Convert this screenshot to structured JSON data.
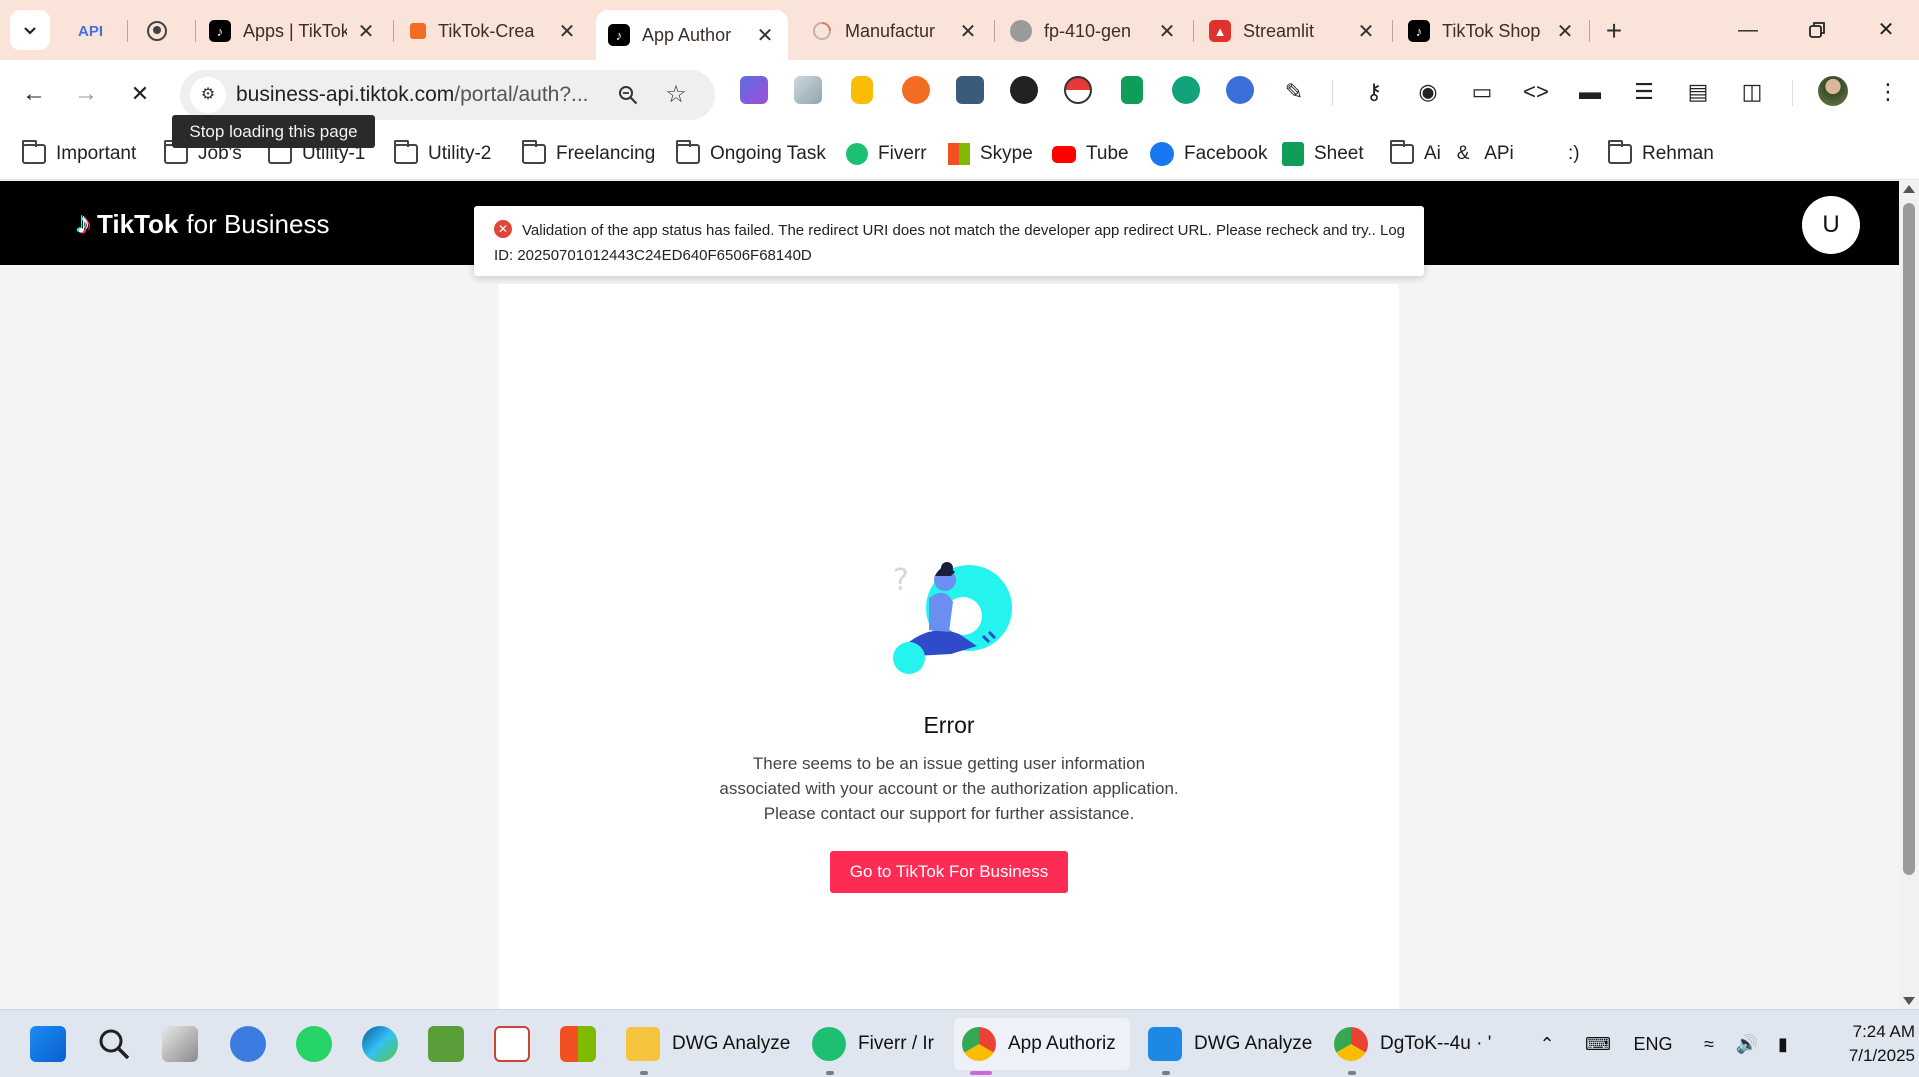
{
  "tabs": [
    {
      "title": "API",
      "favicon": "api-text-icon",
      "has_close": false
    },
    {
      "title": "",
      "favicon": "github-icon",
      "has_close": false
    },
    {
      "title": "Apps | TikTok",
      "favicon": "tiktok-icon",
      "has_close": true
    },
    {
      "title": "TikTok-Crea",
      "favicon": "orange-app-icon",
      "has_close": true
    },
    {
      "title": "App Author",
      "favicon": "tiktok-icon",
      "has_close": true,
      "active": true
    },
    {
      "title": "Manufactur",
      "favicon": "loading-spinner-icon",
      "has_close": true
    },
    {
      "title": "fp-410-gen",
      "favicon": "globe-icon",
      "has_close": true
    },
    {
      "title": "Streamlit",
      "favicon": "streamlit-icon",
      "has_close": true
    },
    {
      "title": "TikTok Shop",
      "favicon": "tiktok-icon",
      "has_close": true
    }
  ],
  "toolbar": {
    "url_host": "business-api.tiktok.com",
    "url_rest": "/portal/auth?...",
    "tooltip": "Stop loading this page"
  },
  "bookmarks": [
    {
      "label": "Important",
      "icon": "folder-icon"
    },
    {
      "label": "Job's",
      "icon": "folder-icon"
    },
    {
      "label": "Utility-1",
      "icon": "folder-icon"
    },
    {
      "label": "Utility-2",
      "icon": "folder-icon"
    },
    {
      "label": "Freelancing",
      "icon": "folder-icon"
    },
    {
      "label": "Ongoing Task",
      "icon": "folder-icon"
    },
    {
      "label": "Fiverr",
      "icon": "fiverr-icon"
    },
    {
      "label": "Skype",
      "icon": "microsoft-icon"
    },
    {
      "label": "Tube",
      "icon": "youtube-icon"
    },
    {
      "label": "Facebook",
      "icon": "facebook-icon"
    },
    {
      "label": "Sheet",
      "icon": "sheets-icon"
    },
    {
      "label": "Ai   &   APi",
      "icon": "folder-icon"
    },
    {
      "label": ":)",
      "icon": ""
    },
    {
      "label": "Rehman",
      "icon": "folder-icon"
    }
  ],
  "page": {
    "brand_main": "TikTok",
    "brand_sub": "for Business",
    "user_initial": "U",
    "toast_text": "Validation of the app status has failed. The redirect URI does not match the developer app redirect URL. Please recheck and try.. Log ID: 20250701012443C24ED640F6506F68140D",
    "error_title": "Error",
    "error_lines": [
      "There seems to be an issue getting user information",
      "associated with your account or the authorization application.",
      "Please contact our support for further assistance."
    ],
    "cta_label": "Go to TikTok For Business"
  },
  "taskbar": {
    "apps": [
      {
        "label": "DWG Analyze",
        "icon": "file-explorer-icon"
      },
      {
        "label": "Fiverr / Ir",
        "icon": "fiverr-icon"
      },
      {
        "label": "App Authoriz",
        "icon": "chrome-icon",
        "active": true
      },
      {
        "label": "DWG Analyze",
        "icon": "vscode-icon"
      },
      {
        "label": "DgToK--4u · '",
        "icon": "chrome-icon"
      }
    ],
    "language": "ENG",
    "time": "7:24 AM",
    "date": "7/1/2025"
  },
  "colors": {
    "accent": "#fe2c55",
    "tab_strip": "#fae3d8",
    "header": "#000000"
  }
}
